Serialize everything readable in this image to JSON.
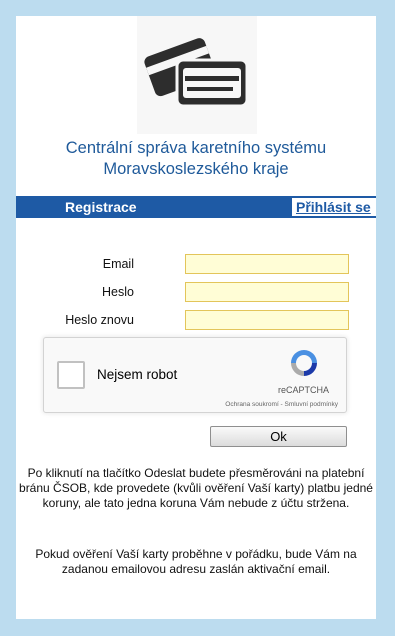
{
  "header": {
    "logo_icon": "payment-cards-icon",
    "title_line1": "Centrální správa karetního systému",
    "title_line2": "Moravskoslezského kraje"
  },
  "nav": {
    "register_label": "Registrace",
    "login_label": "Přihlásit se"
  },
  "form": {
    "email_label": "Email",
    "email_value": "",
    "password_label": "Heslo",
    "password_value": "",
    "password_repeat_label": "Heslo znovu",
    "password_repeat_value": ""
  },
  "recaptcha": {
    "checkbox_label": "Nejsem robot",
    "brand": "reCAPTCHA",
    "links": "Ochrana soukromí - Smluvní podmínky"
  },
  "ok_button": {
    "label": "Ok"
  },
  "info": {
    "paragraph1": "Po kliknutí na tlačítko Odeslat budete přesměrováni na platební bránu ČSOB, kde provedete (kvůli ověření Vaší karty) platbu jedné koruny, ale tato jedna koruna Vám nebude z účtu stržena.",
    "paragraph2": "Pokud ověření Vaší karty proběhne v pořádku, bude Vám na zadanou emailovou adresu zaslán aktivační email."
  },
  "colors": {
    "background": "#bcdcef",
    "nav_bar": "#1e5aa5",
    "title": "#1f5a9a",
    "input_fill": "#fffdd6",
    "input_border": "#e3c55a"
  }
}
